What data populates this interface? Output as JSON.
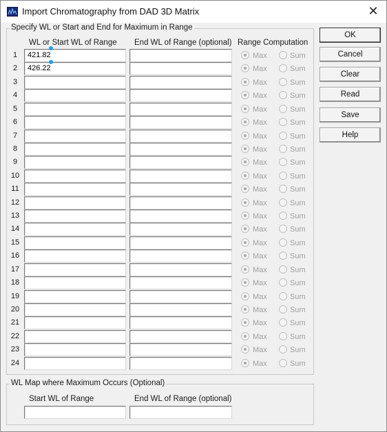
{
  "window": {
    "title": "Import Chromatography from DAD 3D Matrix",
    "close_glyph": "✕"
  },
  "range_group": {
    "legend": "Specify WL or Start and End for Maximum in Range",
    "col_start": "WL or Start WL of Range",
    "col_end": "End WL of Range (optional)",
    "col_computation": "Range Computation",
    "radio_max": "Max",
    "radio_sum": "Sum",
    "rows": [
      {
        "n": "1",
        "start": "421.82",
        "end": ""
      },
      {
        "n": "2",
        "start": "426.22",
        "end": ""
      },
      {
        "n": "3",
        "start": "",
        "end": ""
      },
      {
        "n": "4",
        "start": "",
        "end": ""
      },
      {
        "n": "5",
        "start": "",
        "end": ""
      },
      {
        "n": "6",
        "start": "",
        "end": ""
      },
      {
        "n": "7",
        "start": "",
        "end": ""
      },
      {
        "n": "8",
        "start": "",
        "end": ""
      },
      {
        "n": "9",
        "start": "",
        "end": ""
      },
      {
        "n": "10",
        "start": "",
        "end": ""
      },
      {
        "n": "11",
        "start": "",
        "end": ""
      },
      {
        "n": "12",
        "start": "",
        "end": ""
      },
      {
        "n": "13",
        "start": "",
        "end": ""
      },
      {
        "n": "14",
        "start": "",
        "end": ""
      },
      {
        "n": "15",
        "start": "",
        "end": ""
      },
      {
        "n": "16",
        "start": "",
        "end": ""
      },
      {
        "n": "17",
        "start": "",
        "end": ""
      },
      {
        "n": "18",
        "start": "",
        "end": ""
      },
      {
        "n": "19",
        "start": "",
        "end": ""
      },
      {
        "n": "20",
        "start": "",
        "end": ""
      },
      {
        "n": "21",
        "start": "",
        "end": ""
      },
      {
        "n": "22",
        "start": "",
        "end": ""
      },
      {
        "n": "23",
        "start": "",
        "end": ""
      },
      {
        "n": "24",
        "start": "",
        "end": ""
      }
    ]
  },
  "map_group": {
    "legend": "WL Map where Maximum Occurs (Optional)",
    "col_start": "Start WL of Range",
    "col_end": "End WL of Range (optional)",
    "start_value": "",
    "end_value": ""
  },
  "buttons": {
    "ok": "OK",
    "cancel": "Cancel",
    "clear": "Clear",
    "read": "Read",
    "save": "Save",
    "help": "Help"
  },
  "colors": {
    "accent_marker": "#1fa0e8",
    "disabled_text": "#a0a0a0"
  }
}
